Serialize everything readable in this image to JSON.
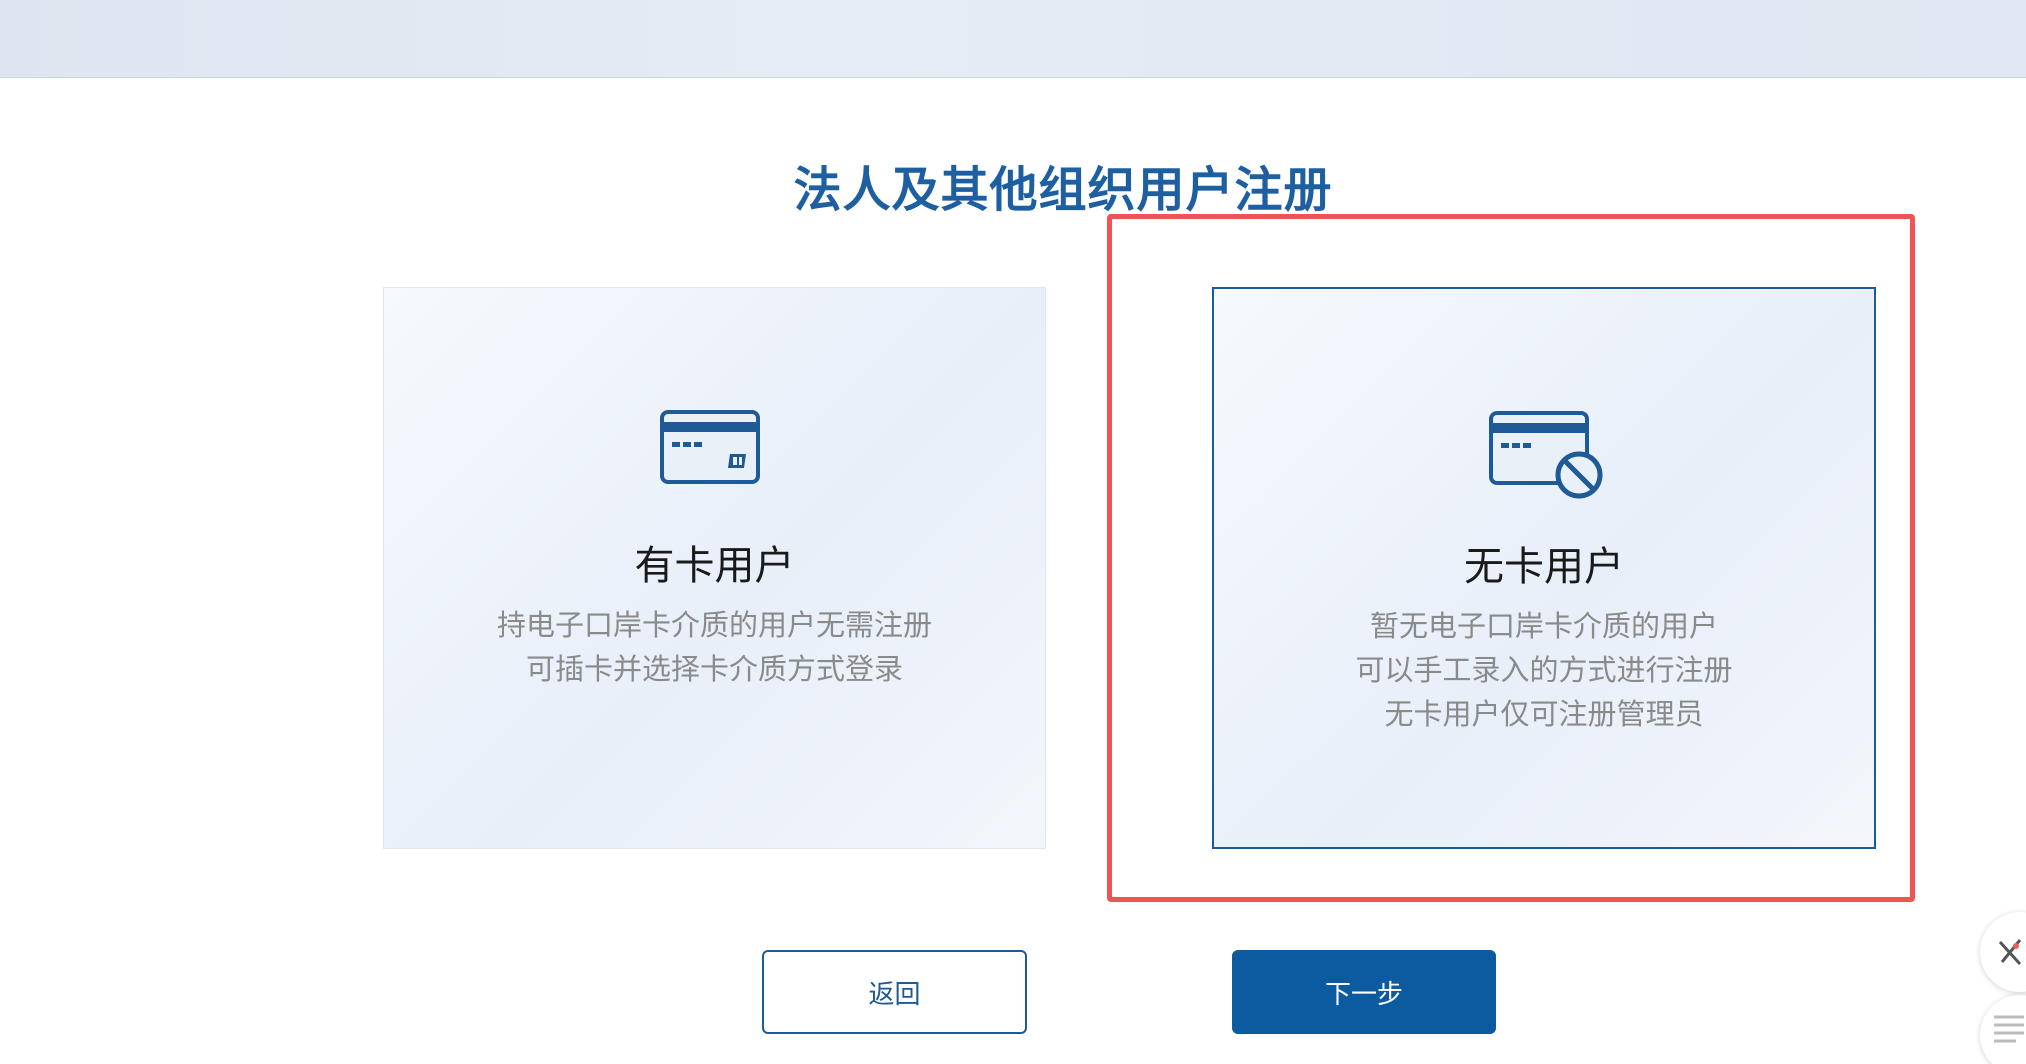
{
  "page": {
    "title": "法人及其他组织用户注册"
  },
  "cards": [
    {
      "id": "with-card",
      "title": "有卡用户",
      "icon": "card-icon",
      "description": [
        "持电子口岸卡介质的用户无需注册",
        "可插卡并选择卡介质方式登录"
      ],
      "selected": false
    },
    {
      "id": "no-card",
      "title": "无卡用户",
      "icon": "no-card-icon",
      "description": [
        "暂无电子口岸卡介质的用户",
        "可以手工录入的方式进行注册",
        "无卡用户仅可注册管理员"
      ],
      "selected": true
    }
  ],
  "buttons": {
    "back_label": "返回",
    "next_label": "下一步"
  },
  "colors": {
    "primary": "#0c5aa0",
    "title": "#1d5fa0",
    "highlight": "#ef5353",
    "desc_text": "#8a8a8a"
  },
  "floating_tools": [
    "draw-tool-icon",
    "note-tool-icon"
  ]
}
